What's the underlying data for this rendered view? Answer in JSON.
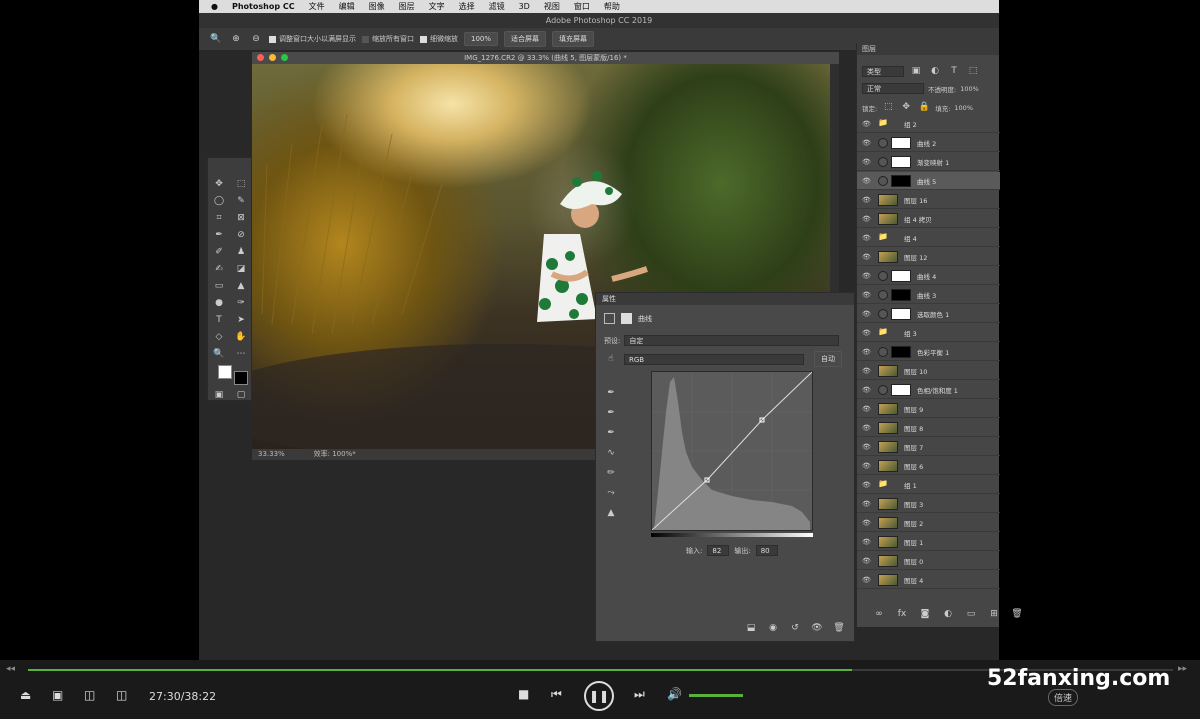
{
  "menubar": {
    "apple": "",
    "app": "Photoshop CC",
    "items": [
      "文件",
      "编辑",
      "图像",
      "图层",
      "文字",
      "选择",
      "滤镜",
      "3D",
      "视图",
      "窗口",
      "帮助"
    ]
  },
  "app_title": "Adobe Photoshop CC 2019",
  "options_bar": {
    "checkboxes": [
      "调整窗口大小以满屏显示",
      "缩放所有窗口",
      "细微缩放"
    ],
    "buttons": [
      "100%",
      "适合屏幕",
      "填充屏幕"
    ]
  },
  "document": {
    "title": "IMG_1276.CR2 @ 33.3% (曲线 5, 图层蒙版/16) *",
    "zoom": "33.33%",
    "status": "效率: 100%*"
  },
  "properties": {
    "title": "属性",
    "type": "曲线",
    "preset_label": "预设:",
    "preset_value": "自定",
    "channel": "RGB",
    "auto_button": "自动",
    "input_label": "输入:",
    "input_value": "82",
    "output_label": "输出:",
    "output_value": "80"
  },
  "layers_panel": {
    "title": "图层",
    "filter_label": "类型",
    "blend_mode": "正常",
    "opacity_label": "不透明度:",
    "opacity_value": "100%",
    "lock_label": "锁定:",
    "fill_label": "填充:",
    "fill_value": "100%",
    "layers": [
      {
        "name": "组 2",
        "kind": "group"
      },
      {
        "name": "曲线 2",
        "kind": "adj"
      },
      {
        "name": "渐变映射 1",
        "kind": "adj"
      },
      {
        "name": "曲线 5",
        "kind": "adj",
        "selected": true
      },
      {
        "name": "图层 16",
        "kind": "pixel"
      },
      {
        "name": "组 4 拷贝",
        "kind": "pixel"
      },
      {
        "name": "组 4",
        "kind": "group"
      },
      {
        "name": "图层 12",
        "kind": "pixel"
      },
      {
        "name": "曲线 4",
        "kind": "adj"
      },
      {
        "name": "曲线 3",
        "kind": "adj"
      },
      {
        "name": "选取颜色 1",
        "kind": "adj"
      },
      {
        "name": "组 3",
        "kind": "group"
      },
      {
        "name": "色彩平衡 1",
        "kind": "adj"
      },
      {
        "name": "图层 10",
        "kind": "pixel"
      },
      {
        "name": "色相/饱和度 1",
        "kind": "adj"
      },
      {
        "name": "图层 9",
        "kind": "pixel"
      },
      {
        "name": "图层 8",
        "kind": "pixel"
      },
      {
        "name": "图层 7",
        "kind": "pixel"
      },
      {
        "name": "图层 6",
        "kind": "pixel"
      },
      {
        "name": "组 1",
        "kind": "group"
      },
      {
        "name": "图层 3",
        "kind": "pixel"
      },
      {
        "name": "图层 2",
        "kind": "pixel"
      },
      {
        "name": "图层 1",
        "kind": "pixel"
      },
      {
        "name": "图层 0",
        "kind": "pixel"
      },
      {
        "name": "图层 4",
        "kind": "pixel"
      }
    ]
  },
  "player": {
    "time": "27:30/38:22",
    "progress": 0.72,
    "speed_button": "倍速",
    "watermark": "52fanxing.com",
    "accent": "#59b33b"
  }
}
